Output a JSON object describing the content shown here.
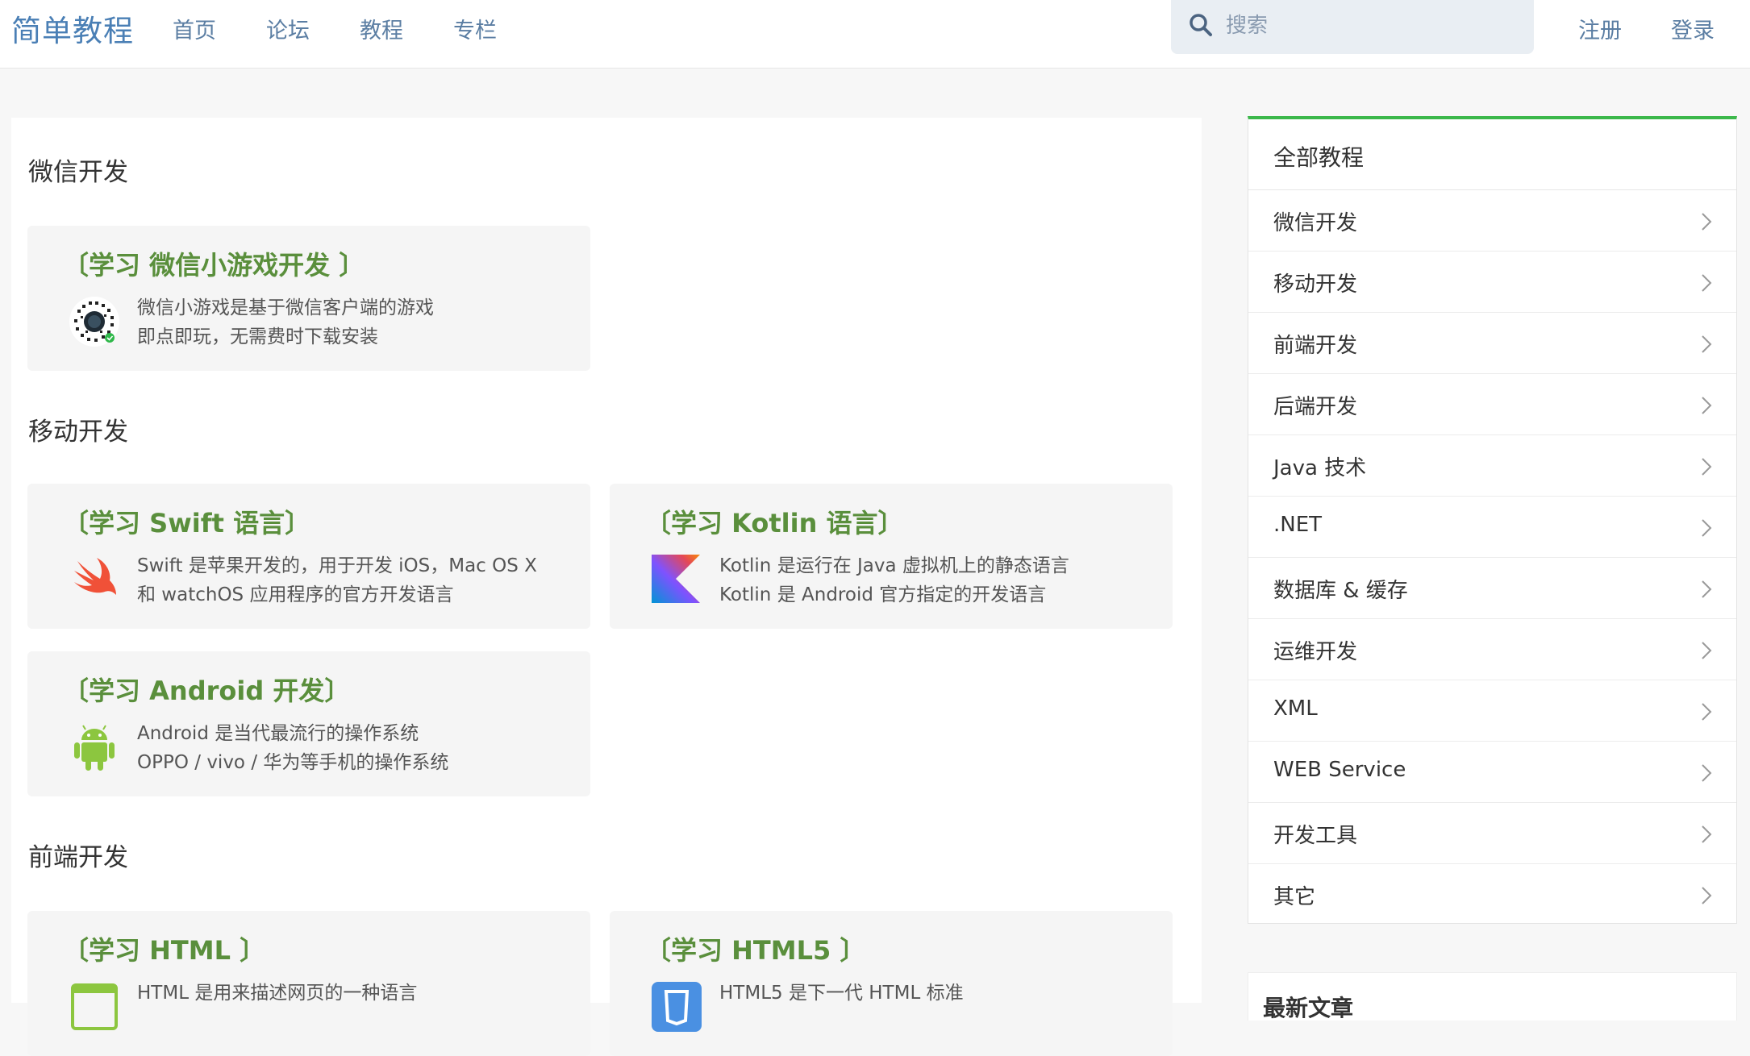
{
  "header": {
    "logo": "简单教程",
    "nav": [
      "首页",
      "论坛",
      "教程",
      "专栏"
    ],
    "search_placeholder": "搜索",
    "register": "注册",
    "login": "登录"
  },
  "sections": [
    {
      "title": "微信开发",
      "cards": [
        {
          "title": "〔学习 微信小游戏开发 〕",
          "icon": "wechat-minigame-qr-icon",
          "desc": [
            "微信小游戏是基于微信客户端的游戏",
            "即点即玩，无需费时下载安装"
          ]
        }
      ]
    },
    {
      "title": "移动开发",
      "cards": [
        {
          "title": "〔学习 Swift 语言〕",
          "icon": "swift-logo-icon",
          "desc": [
            "Swift 是苹果开发的，用于开发 iOS，Mac OS X",
            "和 watchOS 应用程序的官方开发语言"
          ]
        },
        {
          "title": "〔学习 Kotlin 语言〕",
          "icon": "kotlin-logo-icon",
          "desc": [
            "Kotlin 是运行在 Java 虚拟机上的静态语言",
            "Kotlin 是 Android 官方指定的开发语言"
          ]
        },
        {
          "title": "〔学习 Android 开发〕",
          "icon": "android-logo-icon",
          "desc": [
            "Android 是当代最流行的操作系统",
            "OPPO / vivo / 华为等手机的操作系统"
          ]
        }
      ]
    },
    {
      "title": "前端开发",
      "cards": [
        {
          "title": "〔学习 HTML 〕",
          "icon": "html-logo-icon",
          "desc": [
            "HTML 是用来描述网页的一种语言"
          ]
        },
        {
          "title": "〔学习 HTML5 〕",
          "icon": "html5-logo-icon",
          "desc": [
            "HTML5 是下一代 HTML 标准"
          ]
        }
      ]
    }
  ],
  "sidebar": {
    "header": "全部教程",
    "items": [
      "微信开发",
      "移动开发",
      "前端开发",
      "后端开发",
      "Java 技术",
      ".NET",
      "数据库 & 缓存",
      "运维开发",
      "XML",
      "WEB Service",
      "开发工具",
      "其它"
    ]
  },
  "latest": {
    "title": "最新文章"
  },
  "colors": {
    "logo": "#4a7fb5",
    "nav": "#5b7ea3",
    "card_title": "#5a8f3c",
    "sidebar_accent": "#3cb84b"
  }
}
